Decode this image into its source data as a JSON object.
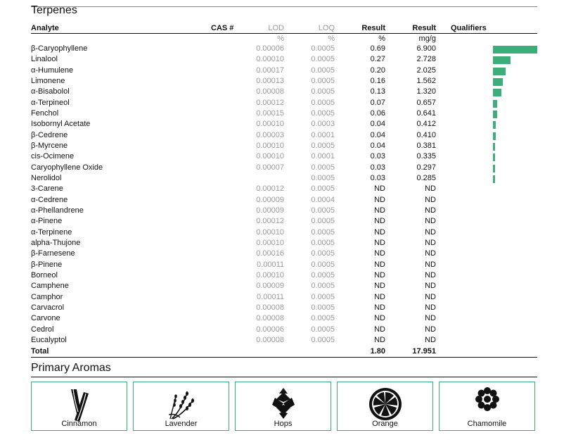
{
  "terpenes": {
    "title": "Terpenes",
    "columns": {
      "analyte": "Analyte",
      "cas": "CAS #",
      "lod": "LOD",
      "loq": "LOQ",
      "result_pct": "Result",
      "result_mg": "Result",
      "qualifiers": "Qualifiers"
    },
    "units": {
      "lod": "%",
      "loq": "%",
      "result_pct": "%",
      "result_mg": "mg/g"
    },
    "bar_color": "#3dae7a",
    "rows": [
      {
        "analyte": "β-Caryophyllene",
        "lod": "0.00006",
        "loq": "0.0005",
        "pct": "0.69",
        "mg": "6.900"
      },
      {
        "analyte": "Linalool",
        "lod": "0.00010",
        "loq": "0.0005",
        "pct": "0.27",
        "mg": "2.728"
      },
      {
        "analyte": "α-Humulene",
        "lod": "0.00017",
        "loq": "0.0005",
        "pct": "0.20",
        "mg": "2.025"
      },
      {
        "analyte": "Limonene",
        "lod": "0.00013",
        "loq": "0.0005",
        "pct": "0.16",
        "mg": "1.562"
      },
      {
        "analyte": "α-Bisabolol",
        "lod": "0.00008",
        "loq": "0.0005",
        "pct": "0.13",
        "mg": "1.320"
      },
      {
        "analyte": "α-Terpineol",
        "lod": "0.00012",
        "loq": "0.0005",
        "pct": "0.07",
        "mg": "0.657"
      },
      {
        "analyte": "Fenchol",
        "lod": "0.00015",
        "loq": "0.0005",
        "pct": "0.06",
        "mg": "0.641"
      },
      {
        "analyte": "Isobornyl Acetate",
        "lod": "0.00010",
        "loq": "0.0003",
        "pct": "0.04",
        "mg": "0.412"
      },
      {
        "analyte": "β-Cedrene",
        "lod": "0.00003",
        "loq": "0.0001",
        "pct": "0.04",
        "mg": "0.410"
      },
      {
        "analyte": "β-Myrcene",
        "lod": "0.00010",
        "loq": "0.0005",
        "pct": "0.04",
        "mg": "0.381"
      },
      {
        "analyte": "cis-Ocimene",
        "lod": "0.00010",
        "loq": "0.0001",
        "pct": "0.03",
        "mg": "0.335"
      },
      {
        "analyte": "Caryophyllene Oxide",
        "lod": "0.00007",
        "loq": "0.0005",
        "pct": "0.03",
        "mg": "0.297"
      },
      {
        "analyte": "Nerolidol",
        "lod": "",
        "loq": "0.0005",
        "pct": "0.03",
        "mg": "0.285"
      },
      {
        "analyte": "3-Carene",
        "lod": "0.00012",
        "loq": "0.0005",
        "pct": "ND",
        "mg": "ND"
      },
      {
        "analyte": "α-Cedrene",
        "lod": "0.00009",
        "loq": "0.0004",
        "pct": "ND",
        "mg": "ND"
      },
      {
        "analyte": "α-Phellandrene",
        "lod": "0.00009",
        "loq": "0.0005",
        "pct": "ND",
        "mg": "ND"
      },
      {
        "analyte": "α-Pinene",
        "lod": "0.00012",
        "loq": "0.0005",
        "pct": "ND",
        "mg": "ND"
      },
      {
        "analyte": "α-Terpinene",
        "lod": "0.00010",
        "loq": "0.0005",
        "pct": "ND",
        "mg": "ND"
      },
      {
        "analyte": "alpha-Thujone",
        "lod": "0.00010",
        "loq": "0.0005",
        "pct": "ND",
        "mg": "ND"
      },
      {
        "analyte": "β-Farnesene",
        "lod": "0.00016",
        "loq": "0.0005",
        "pct": "ND",
        "mg": "ND"
      },
      {
        "analyte": "β-Pinene",
        "lod": "0.00011",
        "loq": "0.0005",
        "pct": "ND",
        "mg": "ND"
      },
      {
        "analyte": "Borneol",
        "lod": "0.00010",
        "loq": "0.0005",
        "pct": "ND",
        "mg": "ND"
      },
      {
        "analyte": "Camphene",
        "lod": "0.00009",
        "loq": "0.0005",
        "pct": "ND",
        "mg": "ND"
      },
      {
        "analyte": "Camphor",
        "lod": "0.00011",
        "loq": "0.0005",
        "pct": "ND",
        "mg": "ND"
      },
      {
        "analyte": "Carvacrol",
        "lod": "0.00008",
        "loq": "0.0005",
        "pct": "ND",
        "mg": "ND"
      },
      {
        "analyte": "Carvone",
        "lod": "0.00008",
        "loq": "0.0005",
        "pct": "ND",
        "mg": "ND"
      },
      {
        "analyte": "Cedrol",
        "lod": "0.00006",
        "loq": "0.0005",
        "pct": "ND",
        "mg": "ND"
      },
      {
        "analyte": "Eucalyptol",
        "lod": "0.00008",
        "loq": "0.0005",
        "pct": "ND",
        "mg": "ND"
      }
    ],
    "total": {
      "label": "Total",
      "pct": "1.80",
      "mg": "17.951"
    }
  },
  "aromas": {
    "title": "Primary Aromas",
    "accent": "#3dae7a",
    "items": [
      {
        "label": "Cinnamon",
        "icon": "cinnamon-icon"
      },
      {
        "label": "Lavender",
        "icon": "lavender-icon"
      },
      {
        "label": "Hops",
        "icon": "hops-icon"
      },
      {
        "label": "Orange",
        "icon": "orange-icon"
      },
      {
        "label": "Chamomile",
        "icon": "chamomile-icon"
      }
    ]
  }
}
